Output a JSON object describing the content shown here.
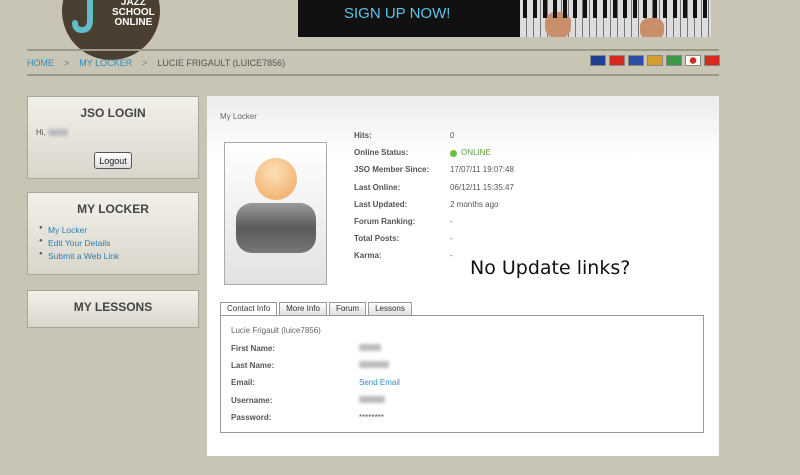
{
  "logo": {
    "line1": "JAZZ",
    "line2": "SCHOOL",
    "line3": "ONLINE"
  },
  "banner": {
    "text": "SIGN UP NOW!"
  },
  "breadcrumb": {
    "home": "HOME",
    "locker": "MY LOCKER",
    "current": "LUCIE FRIGAULT (LUICE7856)",
    "separator": ">"
  },
  "flags": [
    {
      "name": "uk-flag-icon",
      "color": "#1f3f8f"
    },
    {
      "name": "china-flag-icon",
      "color": "#d62a1e"
    },
    {
      "name": "france-flag-icon",
      "color": "#2d4fa6"
    },
    {
      "name": "germany-flag-icon",
      "color": "#d2a02a"
    },
    {
      "name": "italy-flag-icon",
      "color": "#3b9a4a"
    },
    {
      "name": "japan-flag-icon",
      "color": "#ffffff"
    },
    {
      "name": "spain-flag-icon",
      "color": "#d62a1e"
    }
  ],
  "sidebar": {
    "login_title": "JSO LOGIN",
    "hi_text": "Hi,",
    "logout_label": "Logout",
    "locker_title": "MY LOCKER",
    "locker_links": [
      "My Locker",
      "Edit Your Details",
      "Submit a Web Link"
    ],
    "lessons_title": "MY LESSONS"
  },
  "main": {
    "title": "My Locker",
    "info": [
      {
        "label": "Hits:",
        "value": "0"
      },
      {
        "label": "Online Status:",
        "value": "ONLINE"
      },
      {
        "label": "JSO Member Since:",
        "value": "17/07/11 19:07:48"
      },
      {
        "label": "Last Online:",
        "value": "06/12/11 15:35:47"
      },
      {
        "label": "Last Updated:",
        "value": "2 months ago"
      },
      {
        "label": "Forum Ranking:",
        "value": "-"
      },
      {
        "label": "Total Posts:",
        "value": "-"
      },
      {
        "label": "Karma:",
        "value": "-"
      }
    ]
  },
  "annotation": "No Update links?",
  "tabs": [
    "Contact Info",
    "More Info",
    "Forum",
    "Lessons"
  ],
  "contact": {
    "heading": "Lucie Frigault (luice7856)",
    "rows": [
      {
        "label": "First Name:"
      },
      {
        "label": "Last Name:"
      },
      {
        "label": "Email:",
        "value": "Send Email"
      },
      {
        "label": "Username:"
      },
      {
        "label": "Password:",
        "value": "********"
      }
    ]
  }
}
